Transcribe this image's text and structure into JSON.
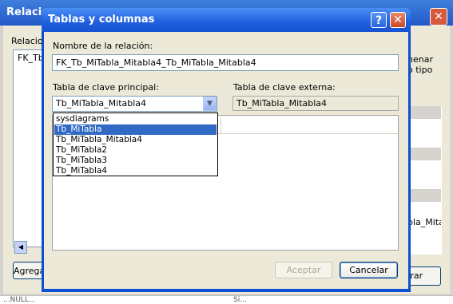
{
  "background_window": {
    "title": "Relaciones",
    "close_glyph": "✕",
    "relations_label": "Relaciones",
    "relations_list_item": "FK_Tb_MiTabla",
    "add_button_label": "Agregar",
    "right_text_line1": "nenar",
    "right_text_line2": "o tipo",
    "grid_text": "bla_Mita",
    "close_button_label": "rrar",
    "scroll_left_glyph": "◀"
  },
  "bottom_strip": {
    "left_text": "...NULL...",
    "right_text": "Si..."
  },
  "dialog": {
    "title": "Tablas y columnas",
    "help_glyph": "?",
    "close_glyph": "✕",
    "relation_name_label": "Nombre de la relación:",
    "relation_name_value": "FK_Tb_MiTabla_Mitabla4_Tb_MiTabla_Mitabla4",
    "primary_key_table_label": "Tabla de clave principal:",
    "primary_key_table_value": "Tb_MiTabla_Mitabla4",
    "foreign_key_table_label": "Tabla de clave externa:",
    "foreign_key_table_value": "Tb_MiTabla_Mitabla4",
    "dropdown_arrow_glyph": "▼",
    "dropdown_options": [
      "sysdiagrams",
      "Tb_MiTabla",
      "Tb_MiTabla_Mitabla4",
      "Tb_MiTabla2",
      "Tb_MiTabla3",
      "Tb_MiTabla4"
    ],
    "dropdown_selected_index": 1,
    "ok_button_label": "Aceptar",
    "cancel_button_label": "Cancelar"
  },
  "colors": {
    "dialog_titlebar": "#1f5fde",
    "dialog_body": "#ece9d8",
    "selection": "#316ac5"
  }
}
